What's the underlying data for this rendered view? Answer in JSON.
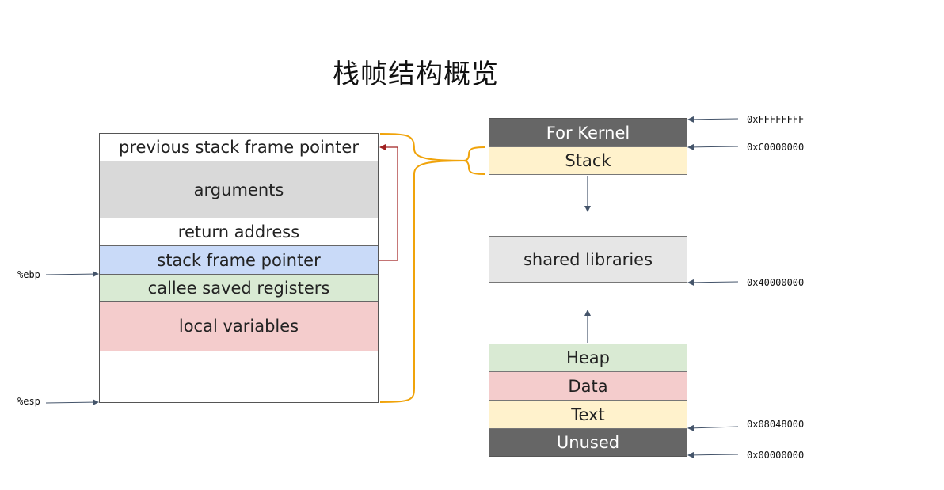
{
  "title": "栈帧结构概览",
  "stack_frame": {
    "rows": [
      {
        "label": "previous stack frame pointer",
        "color": "#ffffff"
      },
      {
        "label": "arguments",
        "color": "#d9d9d9"
      },
      {
        "label": "return address",
        "color": "#ffffff"
      },
      {
        "label": "stack frame pointer",
        "color": "#c9daf8"
      },
      {
        "label": "callee saved registers",
        "color": "#d9ead3"
      },
      {
        "label": "local variables",
        "color": "#f4cccc"
      },
      {
        "label": "",
        "color": "#ffffff"
      }
    ],
    "pointers": {
      "ebp": "%ebp",
      "esp": "%esp"
    }
  },
  "memory_layout": {
    "rows": [
      {
        "label": "For Kernel",
        "color": "#666666",
        "text_color": "#ffffff"
      },
      {
        "label": "Stack",
        "color": "#fff2cc",
        "text_color": "#222222"
      },
      {
        "label": "",
        "color": "#ffffff",
        "text_color": "#222222"
      },
      {
        "label": "shared libraries",
        "color": "#e6e6e6",
        "text_color": "#222222"
      },
      {
        "label": "",
        "color": "#ffffff",
        "text_color": "#222222"
      },
      {
        "label": "Heap",
        "color": "#d9ead3",
        "text_color": "#222222"
      },
      {
        "label": "Data",
        "color": "#f4cccc",
        "text_color": "#222222"
      },
      {
        "label": "Text",
        "color": "#fff2cc",
        "text_color": "#222222"
      },
      {
        "label": "Unused",
        "color": "#666666",
        "text_color": "#ffffff"
      }
    ],
    "addresses": {
      "kernel_top": "0xFFFFFFFF",
      "stack_top": "0xC0000000",
      "shared_libs": "0x40000000",
      "text_start": "0x08048000",
      "bottom": "0x00000000"
    }
  },
  "colors": {
    "brace": "#f0a30a",
    "link_arrow": "#a02020",
    "pointer_arrow": "#44546a"
  }
}
